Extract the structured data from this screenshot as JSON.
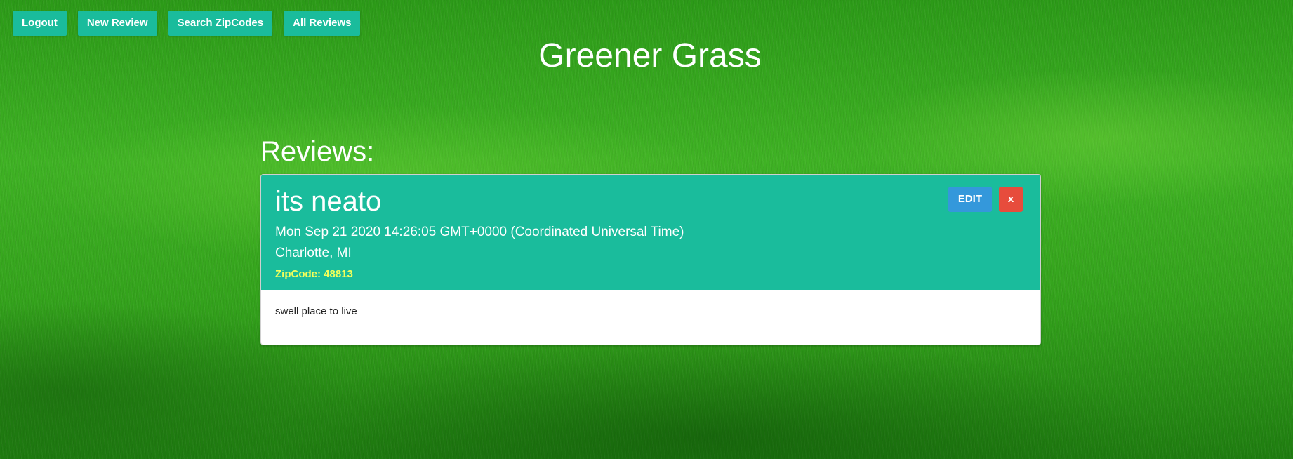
{
  "nav": {
    "logout_label": "Logout",
    "new_review_label": "New Review",
    "search_zipcodes_label": "Search ZipCodes",
    "all_reviews_label": "All Reviews"
  },
  "site": {
    "title": "Greener Grass"
  },
  "reviews": {
    "heading": "Reviews:",
    "items": [
      {
        "title": "its neato",
        "date": "Mon Sep 21 2020 14:26:05 GMT+0000 (Coordinated Universal Time)",
        "location": "Charlotte, MI",
        "zipcode": "ZipCode: 48813",
        "body": "swell place to live",
        "edit_label": "EDIT",
        "delete_label": "x"
      }
    ]
  },
  "colors": {
    "accent": "#1abc9c",
    "edit": "#3498db",
    "delete": "#e74c3c",
    "zipcode": "#f4ff5a"
  }
}
